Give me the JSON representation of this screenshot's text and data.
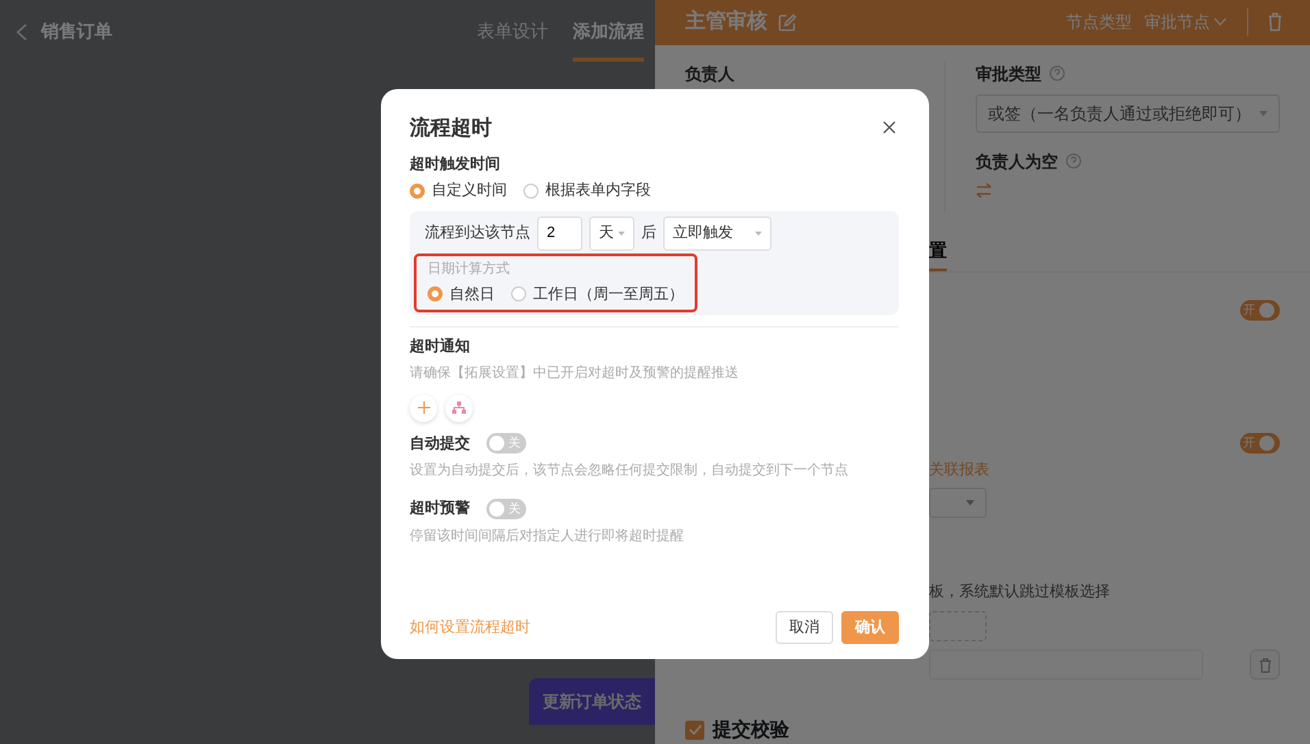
{
  "app_header": {
    "title": "销售订单",
    "tabs": [
      {
        "label": "表单设计",
        "selected": false
      },
      {
        "label": "添加流程",
        "selected": true
      }
    ]
  },
  "canvas": {
    "nodes": [
      {
        "title": "更新订单状态"
      }
    ]
  },
  "node_panel": {
    "title": "主管审核",
    "node_type_label": "节点类型",
    "node_type_value": "审批节点",
    "assignee_label": "负责人",
    "approval_type_label": "审批类型",
    "approval_type_value": "或签（一名负责人通过或拒绝即可）",
    "empty_assignee_label": "负责人为空",
    "tabs": [
      {
        "label": "置",
        "selected": true
      }
    ],
    "toggles": [
      {
        "state_text": "开",
        "on": true
      },
      {
        "state_text": "开",
        "on": true
      }
    ],
    "related_link": "关联报表",
    "template_hint": "板，系统默认跳过模板选择",
    "submit_check": {
      "label": "提交校验",
      "checked": true
    }
  },
  "dialog": {
    "title": "流程超时",
    "trigger": {
      "label": "超时触发时间",
      "options": [
        {
          "label": "自定义时间",
          "selected": true
        },
        {
          "label": "根据表单内字段",
          "selected": false
        }
      ],
      "rule": {
        "prefix": "流程到达该节点",
        "amount": "2",
        "unit": "天",
        "middle": "后",
        "action": "立即触发"
      },
      "date_calc": {
        "label": "日期计算方式",
        "highlighted": true,
        "options": [
          {
            "label": "自然日",
            "selected": true
          },
          {
            "label": "工作日（周一至周五）",
            "selected": false
          }
        ]
      }
    },
    "notify": {
      "label": "超时通知",
      "hint": "请确保【拓展设置】中已开启对超时及预警的提醒推送"
    },
    "switches": [
      {
        "label": "自动提交",
        "on": false,
        "state_text": "关",
        "hint": "设置为自动提交后，该节点会忽略任何提交限制，自动提交到下一个节点"
      },
      {
        "label": "超时预警",
        "on": false,
        "state_text": "关",
        "hint": "停留该时间间隔后对指定人进行即将超时提醒"
      }
    ],
    "help_link": "如何设置流程超时",
    "buttons": [
      {
        "label": "取消",
        "kind": "secondary"
      },
      {
        "label": "确认",
        "kind": "primary"
      }
    ]
  }
}
